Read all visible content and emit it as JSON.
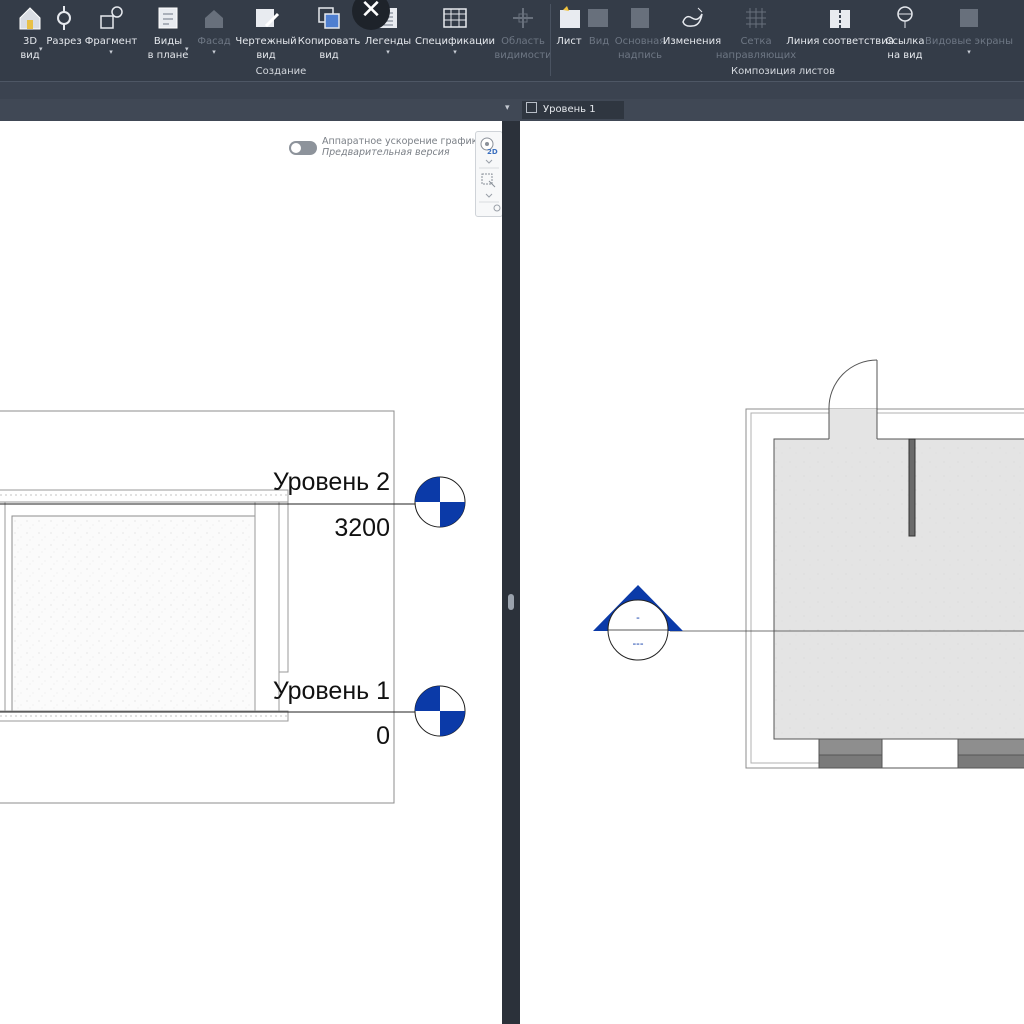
{
  "ribbon": {
    "create_buttons": [
      {
        "label": "3D\nвид",
        "icon": "3d-house-icon",
        "disabled": false
      },
      {
        "label": "Разрез",
        "icon": "section-icon",
        "disabled": false
      },
      {
        "label": "Фрагмент",
        "icon": "callout-icon",
        "disabled": false
      },
      {
        "label": "Виды\nв плане",
        "icon": "plan-views-icon",
        "disabled": false
      },
      {
        "label": "Фасад",
        "icon": "elevation-icon",
        "disabled": true
      },
      {
        "label": "Чертежный\nвид",
        "icon": "drafting-view-icon",
        "disabled": false
      },
      {
        "label": "Копировать\nвид",
        "icon": "duplicate-view-icon",
        "disabled": false
      },
      {
        "label": "Легенды",
        "icon": "legends-icon",
        "disabled": false
      },
      {
        "label": "Спецификации",
        "icon": "schedules-icon",
        "disabled": false
      },
      {
        "label": "Область\nвидимости",
        "icon": "scope-box-icon",
        "disabled": true
      }
    ],
    "create_panel_title": "Создание",
    "sheet_buttons": [
      {
        "label": "Лист",
        "icon": "sheet-icon",
        "disabled": false
      },
      {
        "label": "Вид",
        "icon": "place-view-icon",
        "disabled": true
      },
      {
        "label": "Основная\nнадпись",
        "icon": "title-block-icon",
        "disabled": true
      },
      {
        "label": "Изменения",
        "icon": "revisions-icon",
        "disabled": false
      },
      {
        "label": "Сетка\nнаправляющих",
        "icon": "guide-grid-icon",
        "disabled": true
      },
      {
        "label": "Линия соответствия",
        "icon": "matchline-icon",
        "disabled": false
      },
      {
        "label": "Ссылка\nна вид",
        "icon": "view-reference-icon",
        "disabled": false
      },
      {
        "label": "Видовые экраны",
        "icon": "viewports-icon",
        "disabled": true
      }
    ],
    "sheet_panel_title": "Композиция листов"
  },
  "view_tab": {
    "label": "Уровень 1"
  },
  "hardware_accel": {
    "title": "Аппаратное ускорение графики",
    "subtitle": "Предварительная версия"
  },
  "navbar": {
    "badge": "2D"
  },
  "section_view": {
    "levels": [
      {
        "name": "Уровень 2",
        "elevation": "3200"
      },
      {
        "name": "Уровень 1",
        "elevation": "0"
      }
    ]
  },
  "plan_view": {
    "section_marker": {
      "top_label": "-",
      "bottom_label": "---"
    }
  },
  "colors": {
    "ribbon_bg": "#343c48",
    "level_head_blue": "#0b3aa8",
    "wall_fill": "#e4e4e4"
  }
}
